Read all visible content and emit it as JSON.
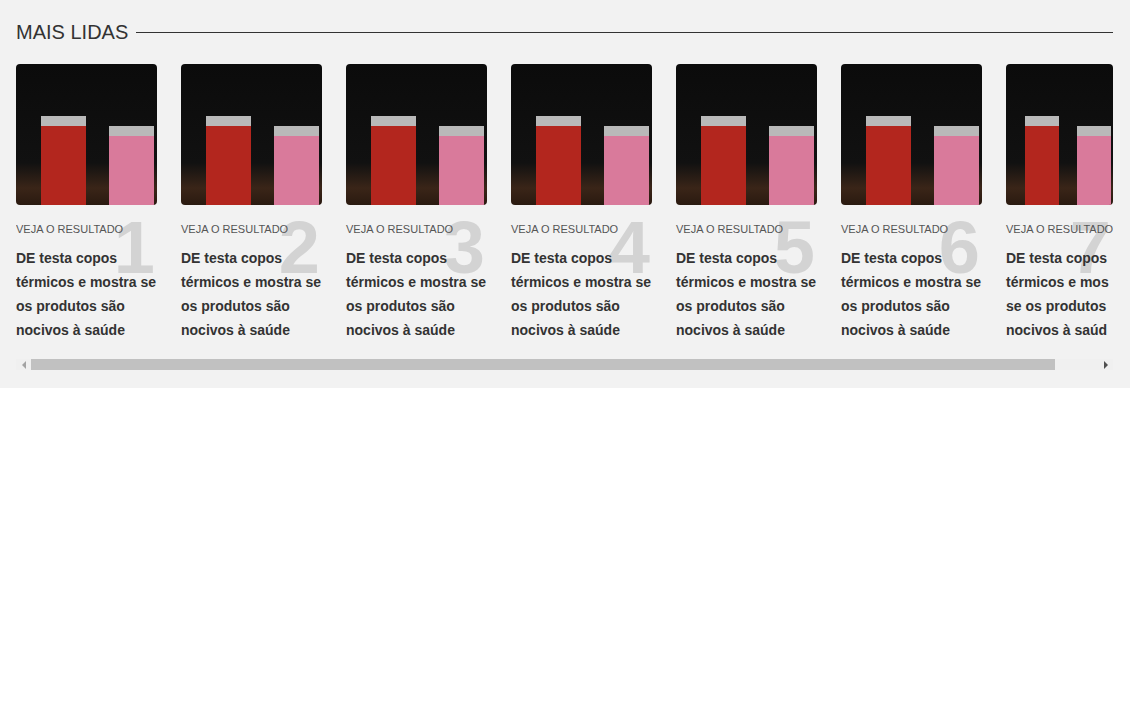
{
  "section": {
    "title": "MAIS LIDAS"
  },
  "cards": [
    {
      "rank": "1",
      "label": "VEJA O RESULTADO",
      "headline": "DE testa copos térmicos e mostra se os produtos são nocivos à saúde",
      "clipped": false
    },
    {
      "rank": "2",
      "label": "VEJA O RESULTADO",
      "headline": "DE testa copos térmicos e mostra se os produtos são nocivos à saúde",
      "clipped": false
    },
    {
      "rank": "3",
      "label": "VEJA O RESULTADO",
      "headline": "DE testa copos térmicos e mostra se os produtos são nocivos à saúde",
      "clipped": false
    },
    {
      "rank": "4",
      "label": "VEJA O RESULTADO",
      "headline": "DE testa copos térmicos e mostra se os produtos são nocivos à saúde",
      "clipped": false
    },
    {
      "rank": "5",
      "label": "VEJA O RESULTADO",
      "headline": "DE testa copos térmicos e mostra se os produtos são nocivos à saúde",
      "clipped": false
    },
    {
      "rank": "6",
      "label": "VEJA O RESULTADO",
      "headline": "DE testa copos térmicos e mostra se os produtos são nocivos à saúde",
      "clipped": false
    },
    {
      "rank": "7",
      "label": "VEJA O RESULTADO",
      "headline": "DE testa copos térmicos e mos se os produtos nocivos à saúd",
      "clipped": true
    }
  ],
  "scrollbar": {
    "level": 0.96
  }
}
